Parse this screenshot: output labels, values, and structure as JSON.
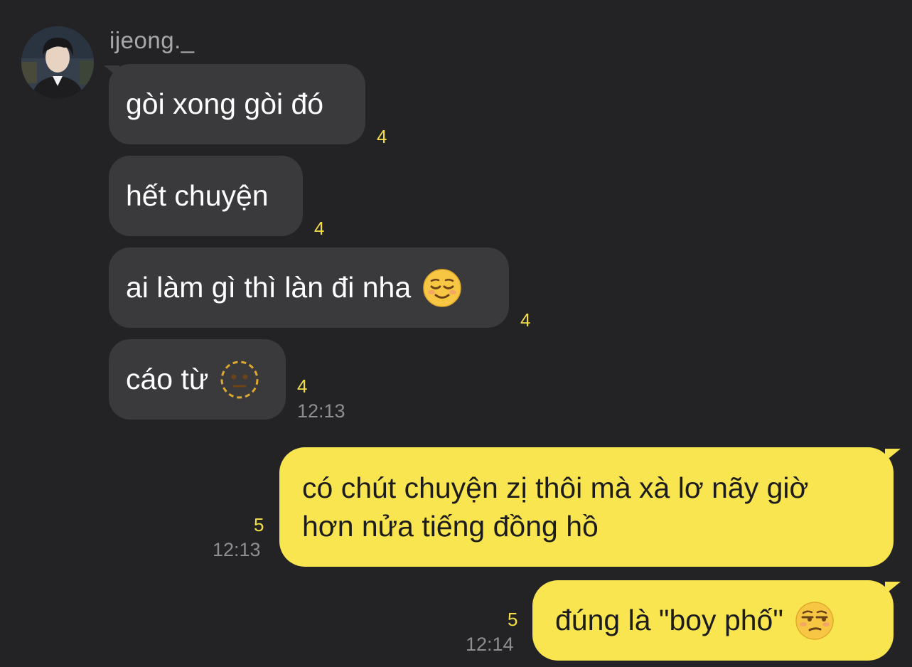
{
  "sender": {
    "name": "ijeong._"
  },
  "incoming": [
    {
      "text": "gòi xong gòi đó",
      "unread": "4"
    },
    {
      "text": "hết chuyện",
      "unread": "4"
    },
    {
      "text": "ai làm gì thì làn đi nha",
      "emoji": "relieved-face-icon",
      "unread": "4"
    },
    {
      "text": "cáo từ",
      "emoji": "dotted-line-face-icon",
      "unread": "4",
      "time": "12:13"
    }
  ],
  "outgoing": [
    {
      "line1": "có chút chuyện zị thôi mà xà lơ nãy giờ",
      "line2": "hơn nửa tiếng đồng hồ",
      "unread": "5",
      "time": "12:13"
    },
    {
      "text": "đúng là \"boy phố\"",
      "emoji": "unamused-face-icon",
      "unread": "5",
      "time": "12:14"
    }
  ],
  "colors": {
    "background": "#232326",
    "incoming_bubble": "#3a3a3d",
    "outgoing_bubble": "#f9e54f",
    "unread_count": "#f3dd45"
  }
}
